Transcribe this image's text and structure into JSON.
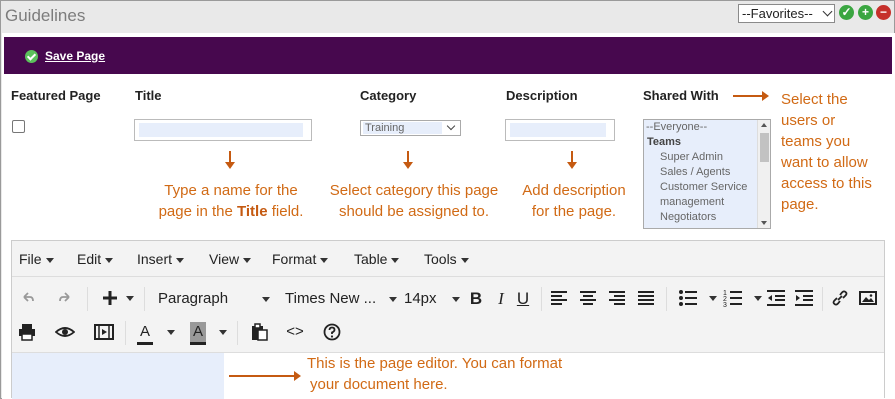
{
  "window": {
    "title": "Guidelines",
    "favorites_value": "--Favorites--",
    "colors": {
      "accent_bar": "#47084e",
      "annotation": "#c55a11",
      "ok_green": "#3aa641",
      "delete_red": "#c6302b"
    }
  },
  "toolbar": {
    "save_label": "Save Page"
  },
  "form": {
    "headers": {
      "featured": "Featured Page",
      "title": "Title",
      "category": "Category",
      "description": "Description",
      "shared_with": "Shared With"
    },
    "category_value": "Training",
    "shared_options": [
      {
        "label": "--Everyone--",
        "kind": "first"
      },
      {
        "label": "Teams",
        "kind": "group"
      },
      {
        "label": "Super Admin",
        "kind": "sub"
      },
      {
        "label": "Sales / Agents",
        "kind": "sub"
      },
      {
        "label": "Customer Service",
        "kind": "sub"
      },
      {
        "label": "management",
        "kind": "sub"
      },
      {
        "label": "Negotiators",
        "kind": "sub"
      }
    ]
  },
  "annotations": {
    "title_note_line1": "Type a name for the",
    "title_note_line2a": "page in the ",
    "title_note_bold": "Title",
    "title_note_line2b": " field.",
    "category_note_line1": "Select category this page",
    "category_note_line2": "should be assigned to.",
    "description_note_line1": "Add description",
    "description_note_line2": "for the page.",
    "shared_note_lines": [
      "Select the",
      "users or",
      "teams you",
      "want to allow",
      "access to this",
      "page."
    ],
    "editor_note_line1": "This is the page editor. You can format",
    "editor_note_line2": "your document here."
  },
  "editor": {
    "menus": [
      "File",
      "Edit",
      "Insert",
      "View",
      "Format",
      "Table",
      "Tools"
    ],
    "paragraph_style": "Paragraph",
    "font_family": "Times New ...",
    "font_size": "14px",
    "icons": [
      "undo-icon",
      "redo-icon",
      "insert-plus-icon",
      "bold-icon",
      "italic-icon",
      "underline-icon",
      "align-left-icon",
      "align-center-icon",
      "align-right-icon",
      "justify-icon",
      "bullet-list-icon",
      "numbered-list-icon",
      "outdent-icon",
      "indent-icon",
      "link-icon",
      "image-icon",
      "print-icon",
      "preview-icon",
      "media-icon",
      "text-color-icon",
      "background-color-icon",
      "paste-icon",
      "source-code-icon",
      "help-icon"
    ],
    "text_color_letter": "A",
    "bg_color_letter": "A",
    "bold_letter": "B",
    "italic_letter": "I",
    "underline_letter": "U"
  }
}
